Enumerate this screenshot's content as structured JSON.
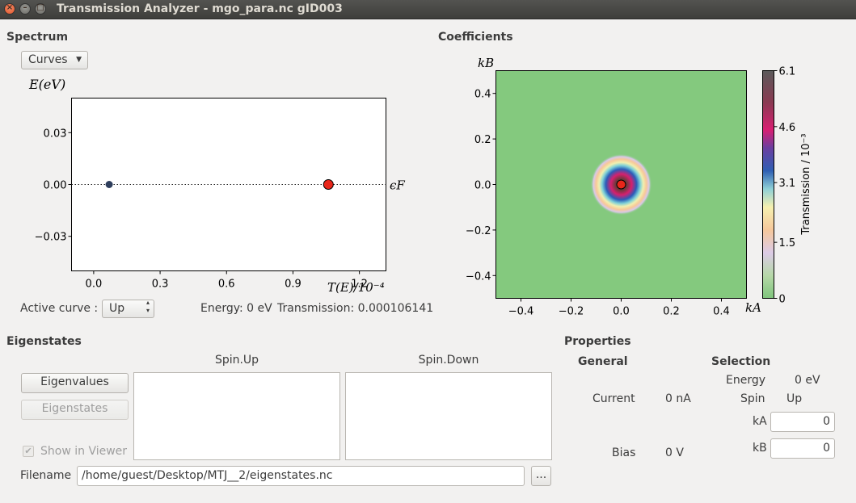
{
  "window": {
    "title": "Transmission Analyzer - mgo_para.nc gID003"
  },
  "spectrum": {
    "section_title": "Spectrum",
    "mode_select": "Curves",
    "y_axis_label": "E(eV)",
    "x_axis_label": "T(E)/10⁻⁴",
    "fermi_label": "ϵF",
    "y_ticks": [
      "0.03",
      "0.00",
      "−0.03"
    ],
    "x_ticks": [
      "0.0",
      "0.3",
      "0.6",
      "0.9",
      "1.2"
    ],
    "active_curve_label": "Active curve :",
    "active_curve_value": "Up",
    "energy_readout": "Energy: 0 eV",
    "transmission_readout": "Transmission: 0.000106141",
    "colors": {
      "point_dark": "#2e3e5c",
      "point_active": "#e8261a"
    }
  },
  "chart_data": [
    {
      "type": "scatter",
      "title": "",
      "xlabel": "T(E)/10⁻⁴",
      "ylabel": "E(eV)",
      "xlim": [
        -0.1,
        1.32
      ],
      "ylim": [
        -0.05,
        0.05
      ],
      "annotations": [
        "ϵF"
      ],
      "series": [
        {
          "values": [
            {
              "x": 0.07,
              "y": 0.0
            },
            {
              "x": 1.06,
              "y": 0.0
            }
          ]
        }
      ]
    },
    {
      "type": "heatmap",
      "title": "Coefficients",
      "xlabel": "kA",
      "ylabel": "kB",
      "xlim": [
        -0.5,
        0.5
      ],
      "ylim": [
        -0.5,
        0.5
      ],
      "x_ticks": [
        "−0.4",
        "−0.2",
        "0.0",
        "0.2",
        "0.4"
      ],
      "y_ticks": [
        "0.4",
        "0.2",
        "0.0",
        "−0.2",
        "−0.4"
      ],
      "colorbar_label": "Transmission / 10⁻³",
      "colorbar_ticks": [
        "6.1",
        "4.6",
        "3.1",
        "1.5",
        "0"
      ],
      "colorbar_range": [
        0,
        6.1
      ],
      "peak": {
        "kA": 0.0,
        "kB": 0.0
      },
      "selected_point": {
        "kA": 0.0,
        "kB": 0.0
      }
    }
  ],
  "coefficients": {
    "section_title": "Coefficients",
    "x_axis_label": "kA",
    "y_axis_label": "kB",
    "colorbar_label": "Transmission / 10⁻³",
    "x_ticks": [
      "−0.4",
      "−0.2",
      "0.0",
      "0.2",
      "0.4"
    ],
    "y_ticks": [
      "0.4",
      "0.2",
      "0.0",
      "−0.2",
      "−0.4"
    ],
    "colorbar_ticks": [
      "6.1",
      "4.6",
      "3.1",
      "1.5",
      "0"
    ]
  },
  "eigenstates": {
    "section_title": "Eigenstates",
    "spin_up_header": "Spin.Up",
    "spin_down_header": "Spin.Down",
    "eigenvalues_button": "Eigenvalues",
    "eigenstates_button": "Eigenstates",
    "show_in_viewer": "Show in Viewer",
    "filename_label": "Filename",
    "filename_value": "/home/guest/Desktop/MTJ__2/eigenstates.nc",
    "browse_button": "..."
  },
  "properties": {
    "section_title": "Properties",
    "general_title": "General",
    "selection_title": "Selection",
    "current_label": "Current",
    "current_value": "0 nA",
    "bias_label": "Bias",
    "bias_value": "0 V",
    "energy_label": "Energy",
    "energy_value": "0 eV",
    "spin_label": "Spin",
    "spin_value": "Up",
    "ka_label": "kA",
    "ka_value": "0",
    "kb_label": "kB",
    "kb_value": "0"
  }
}
